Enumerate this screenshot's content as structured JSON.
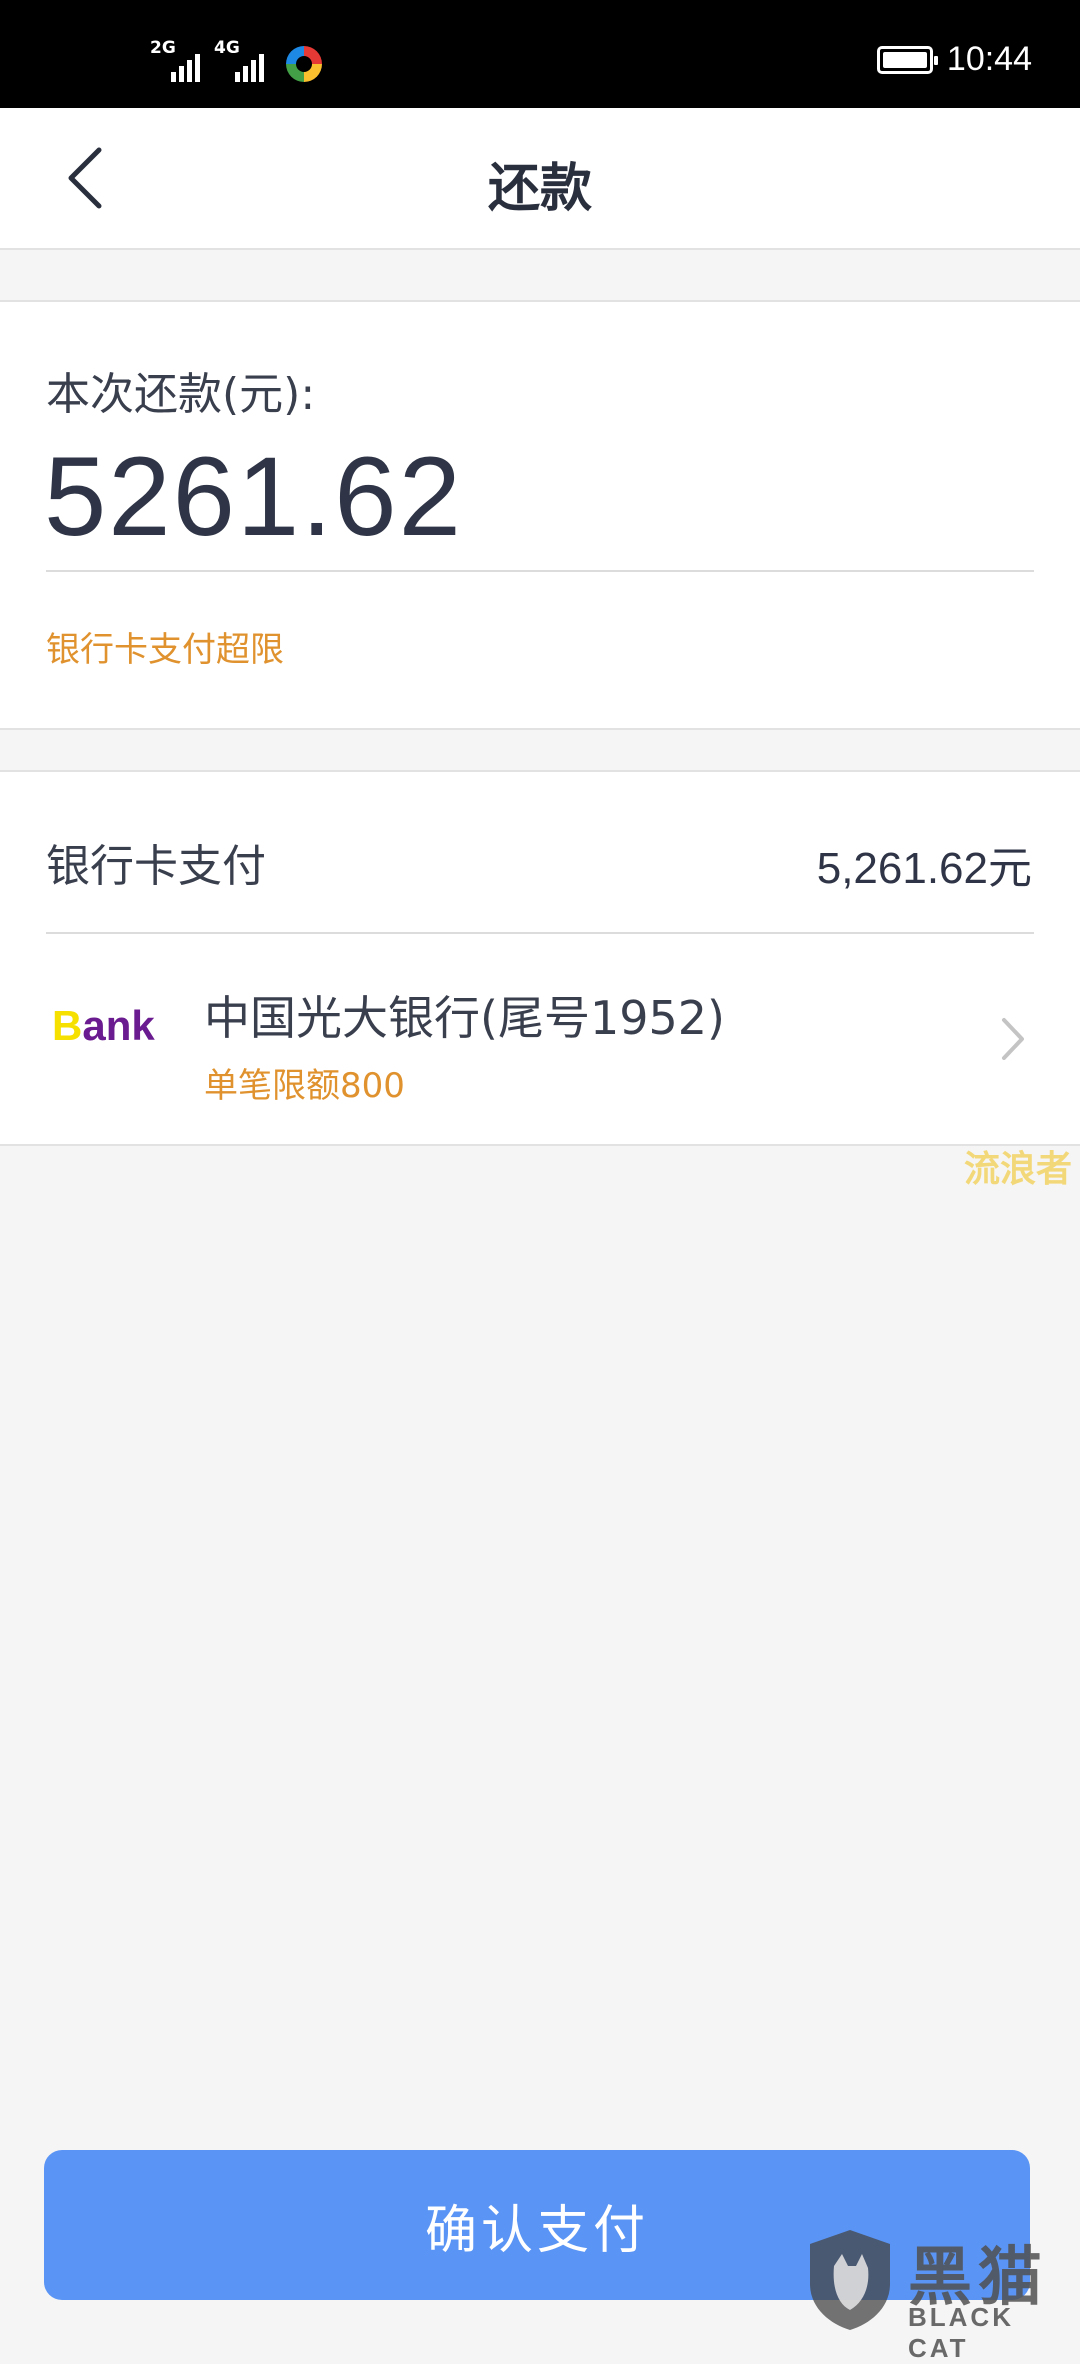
{
  "status_bar": {
    "signal_1_label": "2G",
    "signal_2_label": "4G",
    "time": "10:44"
  },
  "nav": {
    "title": "还款",
    "back_icon": "chevron-left-icon"
  },
  "amount": {
    "label": "本次还款(元):",
    "value": "5261.62",
    "warning": "银行卡支付超限"
  },
  "payment": {
    "method_label": "银行卡支付",
    "method_amount": "5,261.62元",
    "card": {
      "logo_text_first": "B",
      "logo_text_rest": "ank",
      "name": "中国光大银行(尾号1952)",
      "limit": "单笔限额800"
    }
  },
  "watermark": {
    "text": "流浪者"
  },
  "confirm": {
    "label": "确认支付"
  },
  "brand_watermark": {
    "cn": "黑猫",
    "en": "BLACK CAT"
  },
  "colors": {
    "accent_blue": "#5a95f5",
    "warning_orange": "#e0922e",
    "text_dark": "#2f3546"
  }
}
